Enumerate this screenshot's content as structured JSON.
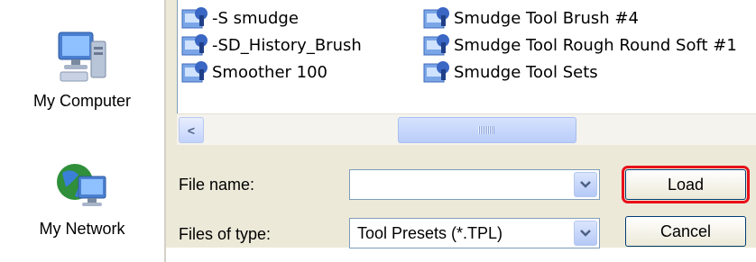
{
  "places": [
    {
      "label": "My Computer",
      "icon": "my-computer-icon"
    },
    {
      "label": "My Network",
      "icon": "my-network-icon"
    }
  ],
  "files": {
    "column1": [
      {
        "name": "-S smudge",
        "icon": "brush-preset-icon"
      },
      {
        "name": "-SD_History_Brush",
        "icon": "brush-preset-icon"
      },
      {
        "name": "Smoother 100",
        "icon": "brush-preset-icon"
      }
    ],
    "column2": [
      {
        "name": "Smudge Tool Brush #4",
        "icon": "brush-preset-icon"
      },
      {
        "name": "Smudge Tool Rough Round Soft #1",
        "icon": "brush-preset-icon"
      },
      {
        "name": "Smudge Tool Sets",
        "icon": "brush-preset-icon"
      }
    ]
  },
  "scrollbar": {
    "left_arrow": "<"
  },
  "form": {
    "file_name_label": "File name:",
    "file_name_value": "",
    "file_type_label": "Files of type:",
    "file_type_value": "Tool Presets (*.TPL)"
  },
  "buttons": {
    "load": "Load",
    "cancel": "Cancel"
  },
  "colors": {
    "highlight": "#e8101a",
    "dialog_bg": "#ece9d8",
    "border": "#7f9db9"
  }
}
